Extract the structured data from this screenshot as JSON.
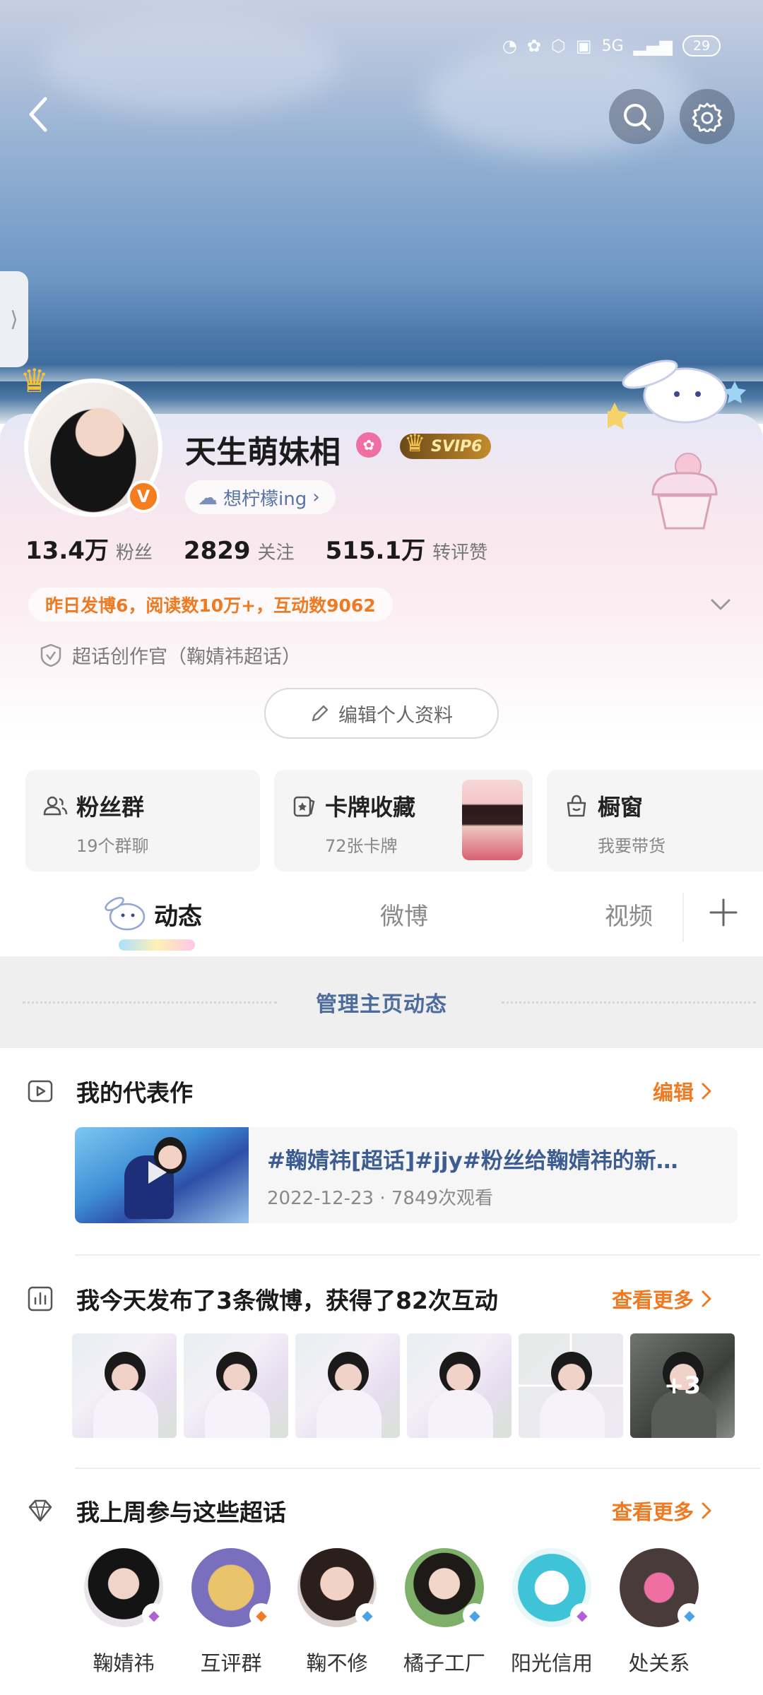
{
  "status_bar": {
    "network": "5G",
    "battery": "29"
  },
  "profile": {
    "name": "天生萌妹相",
    "vip_badge": "SVIP6",
    "mood": "想柠檬ing",
    "verified_badge": "V",
    "stats": [
      {
        "value": "13.4万",
        "label": "粉丝"
      },
      {
        "value": "2829",
        "label": "关注"
      },
      {
        "value": "515.1万",
        "label": "转评赞"
      }
    ],
    "notice": "昨日发博6，阅读数10万+，互动数9062",
    "supertalk_role": "超话创作官（鞠婧祎超话）",
    "edit_button": "编辑个人资料"
  },
  "features": [
    {
      "title": "粉丝群",
      "subtitle": "19个群聊",
      "icon": "people-icon"
    },
    {
      "title": "卡牌收藏",
      "subtitle": "72张卡牌",
      "icon": "card-icon"
    },
    {
      "title": "橱窗",
      "subtitle": "我要带货",
      "icon": "bag-icon"
    }
  ],
  "tabs": [
    {
      "label": "动态",
      "active": true
    },
    {
      "label": "微博",
      "active": false
    },
    {
      "label": "视频",
      "active": false
    }
  ],
  "manage_feed": "管理主页动态",
  "representative": {
    "title": "我的代表作",
    "action": "编辑",
    "item": {
      "title": "#鞠婧祎[超话]#jjy#粉丝给鞠婧祎的新…",
      "meta": "2022-12-23 · 7849次观看"
    }
  },
  "today": {
    "title": "我今天发布了3条微博，获得了82次互动",
    "action": "查看更多",
    "more_count": "+3"
  },
  "supertopics": {
    "title": "我上周参与这些超话",
    "action": "查看更多",
    "items": [
      {
        "name": "鞠婧祎"
      },
      {
        "name": "互评群"
      },
      {
        "name": "鞠不修"
      },
      {
        "name": "橘子工厂"
      },
      {
        "name": "阳光信用"
      },
      {
        "name": "处关系"
      }
    ]
  },
  "colors": {
    "accent_orange": "#f07a21",
    "link_blue": "#3d5d92",
    "verified": "#f57c1f"
  }
}
